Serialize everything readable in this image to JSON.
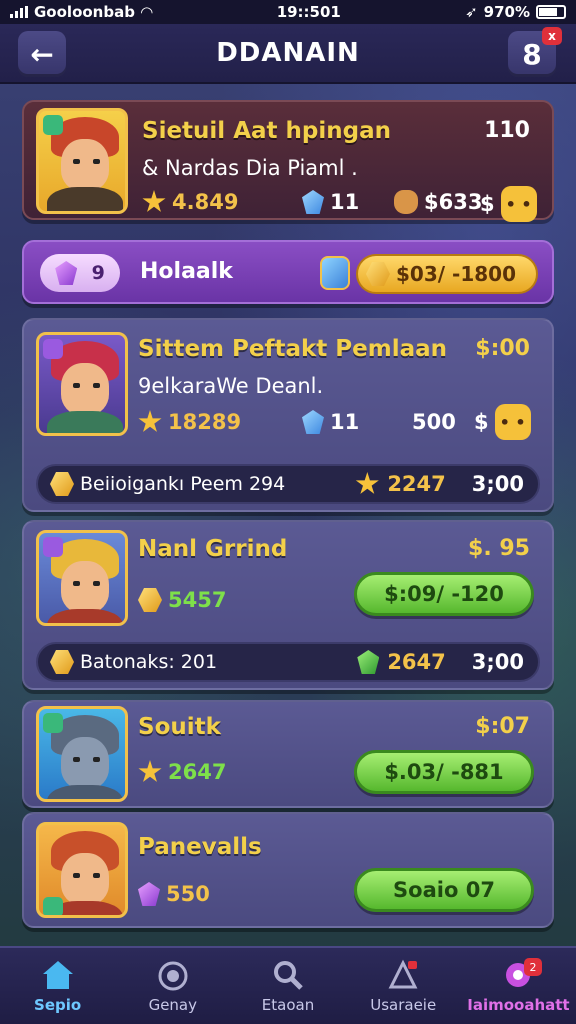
{
  "status_bar": {
    "carrier": "Gooloonbab",
    "time": "19::501",
    "battery": "970%"
  },
  "header": {
    "title": "DDANAIN",
    "notif_count": "8",
    "notif_badge": "x"
  },
  "cards": [
    {
      "title": "Sietuil Aat hpingan",
      "subtitle": "& Nardas Dia Piaml .",
      "price": "110",
      "stars": "4.849",
      "gems": "11",
      "bag": "$633",
      "currency": "$"
    },
    {
      "title": "Sittem Peftakt Pemlaan",
      "subtitle": "9elkaraWe Deanl.",
      "price": "$:00",
      "stars": "18289",
      "gems": "11",
      "count": "500",
      "currency": "$",
      "strip_label": "Beiioigankı Peem 294",
      "strip_value": "2247",
      "strip_price": "3;00"
    },
    {
      "title": "Nanl Grrind",
      "price": "$. 95",
      "coins": "5457",
      "button": "$:09/ -120",
      "strip_label": "Batonaks: 201",
      "strip_value": "2647",
      "strip_price": "3;00"
    },
    {
      "title": "Souitk",
      "price": "$:07",
      "stars": "2647",
      "button": "$.03/ -881"
    },
    {
      "title": "Panevalls",
      "gems": "550",
      "button": "Soaio 07"
    }
  ],
  "purple_bar": {
    "chip_value": "9",
    "label": "Holaalk",
    "price": "$03/ -1800"
  },
  "bottom_nav": [
    {
      "label": "Sepio",
      "icon": "home-icon"
    },
    {
      "label": "Genay",
      "icon": "camera-icon"
    },
    {
      "label": "Etaoan",
      "icon": "search-icon"
    },
    {
      "label": "Usaraeie",
      "icon": "tools-icon"
    },
    {
      "label": "Iaimooahatt",
      "icon": "flower-icon",
      "badge": "2"
    }
  ],
  "colors": {
    "accent_gold": "#f3d04a",
    "green_button": "#56b82e",
    "purple_bar": "#6a34a6",
    "nav_active": "#6ec8ff",
    "nav_highlight": "#e070e8"
  }
}
